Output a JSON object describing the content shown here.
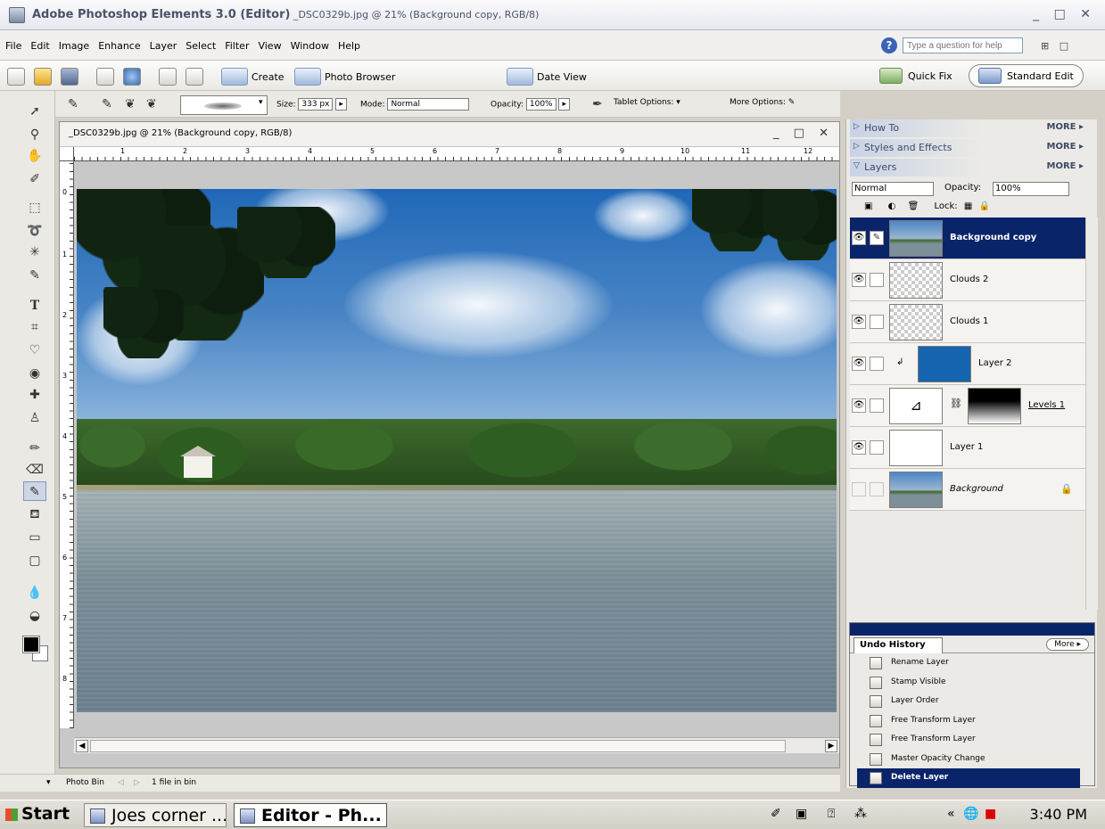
{
  "window": {
    "title_bold": "Adobe Photoshop Elements 3.0 (Editor)",
    "title_rest": " _DSC0329b.jpg @ 21% (Background copy, RGB/8)",
    "controls": "_ □ ✕"
  },
  "menubar": {
    "items": [
      "File",
      "Edit",
      "Image",
      "Enhance",
      "Layer",
      "Select",
      "Filter",
      "View",
      "Window",
      "Help"
    ],
    "help_placeholder": "Type a question for help",
    "help_icon": "?"
  },
  "shortcuts": {
    "create": "Create",
    "photo_browser": "Photo Browser",
    "date_view": "Date View",
    "quick_fix": "Quick Fix",
    "standard_edit": "Standard Edit"
  },
  "options": {
    "size_label": "Size:",
    "size_value": "333 px",
    "mode_label": "Mode:",
    "mode_value": "Normal",
    "opacity_label": "Opacity:",
    "opacity_value": "100%",
    "tablet_options": "Tablet Options:",
    "more_options": "More Options:"
  },
  "document": {
    "title": "_DSC0329b.jpg @ 21% (Background copy, RGB/8)",
    "controls": "_ □ ✕",
    "ruler_top": [
      "1",
      "2",
      "3",
      "4",
      "5",
      "6",
      "7",
      "8",
      "9",
      "10",
      "11",
      "12"
    ],
    "ruler_left": [
      "0",
      "1",
      "2",
      "3",
      "4",
      "5",
      "6",
      "7",
      "8"
    ]
  },
  "photobin": {
    "label": "Photo Bin",
    "count": "1 file in bin"
  },
  "palettes": {
    "howto": "How To",
    "styles": "Styles and Effects",
    "layers": "Layers",
    "more": "MORE"
  },
  "layers_panel": {
    "blend_mode": "Normal",
    "opacity_label": "Opacity:",
    "opacity_value": "100%",
    "lock_label": "Lock:",
    "layers": [
      {
        "name": "Background copy",
        "selected": true
      },
      {
        "name": "Clouds 2",
        "selected": false
      },
      {
        "name": "Clouds 1",
        "selected": false
      },
      {
        "name": "Layer 2",
        "selected": false
      },
      {
        "name": "Levels 1",
        "selected": false
      },
      {
        "name": "Layer 1",
        "selected": false
      },
      {
        "name": "Background",
        "selected": false
      }
    ]
  },
  "undo_history": {
    "tab": "Undo History",
    "more": "More",
    "items": [
      "Rename Layer",
      "Stamp Visible",
      "Layer Order",
      "Free Transform Layer",
      "Free Transform Layer",
      "Master Opacity Change",
      "Delete Layer"
    ]
  },
  "taskbar": {
    "start": "Start",
    "tasks": [
      "Joes corner ...",
      "Editor - Ph..."
    ],
    "clock": "3:40 PM"
  },
  "colors": {
    "selection": "#0a246a",
    "layer2_fill": "#1565b0"
  }
}
